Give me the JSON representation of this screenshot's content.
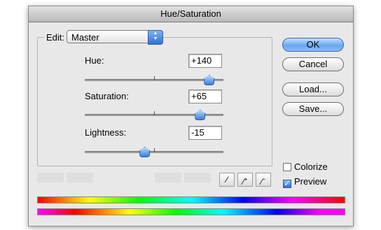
{
  "window": {
    "title": "Hue/Saturation"
  },
  "edit": {
    "label": "Edit:",
    "selected": "Master"
  },
  "hue": {
    "label": "Hue:",
    "value": "+140",
    "level": 0.89
  },
  "saturation": {
    "label": "Saturation:",
    "value": "+65",
    "level": 0.825
  },
  "lightness": {
    "label": "Lightness:",
    "value": "-15",
    "level": 0.425
  },
  "buttons": {
    "ok": "OK",
    "cancel": "Cancel",
    "load": "Load...",
    "save": "Save..."
  },
  "options": {
    "colorize": {
      "label": "Colorize",
      "checked": false
    },
    "preview": {
      "label": "Preview",
      "checked": true
    }
  },
  "icons": {
    "eyedroppers": [
      "eyedropper-icon",
      "eyedropper-plus-icon",
      "eyedropper-minus-icon"
    ]
  },
  "colors": {
    "accent": "#3b7fd9"
  }
}
